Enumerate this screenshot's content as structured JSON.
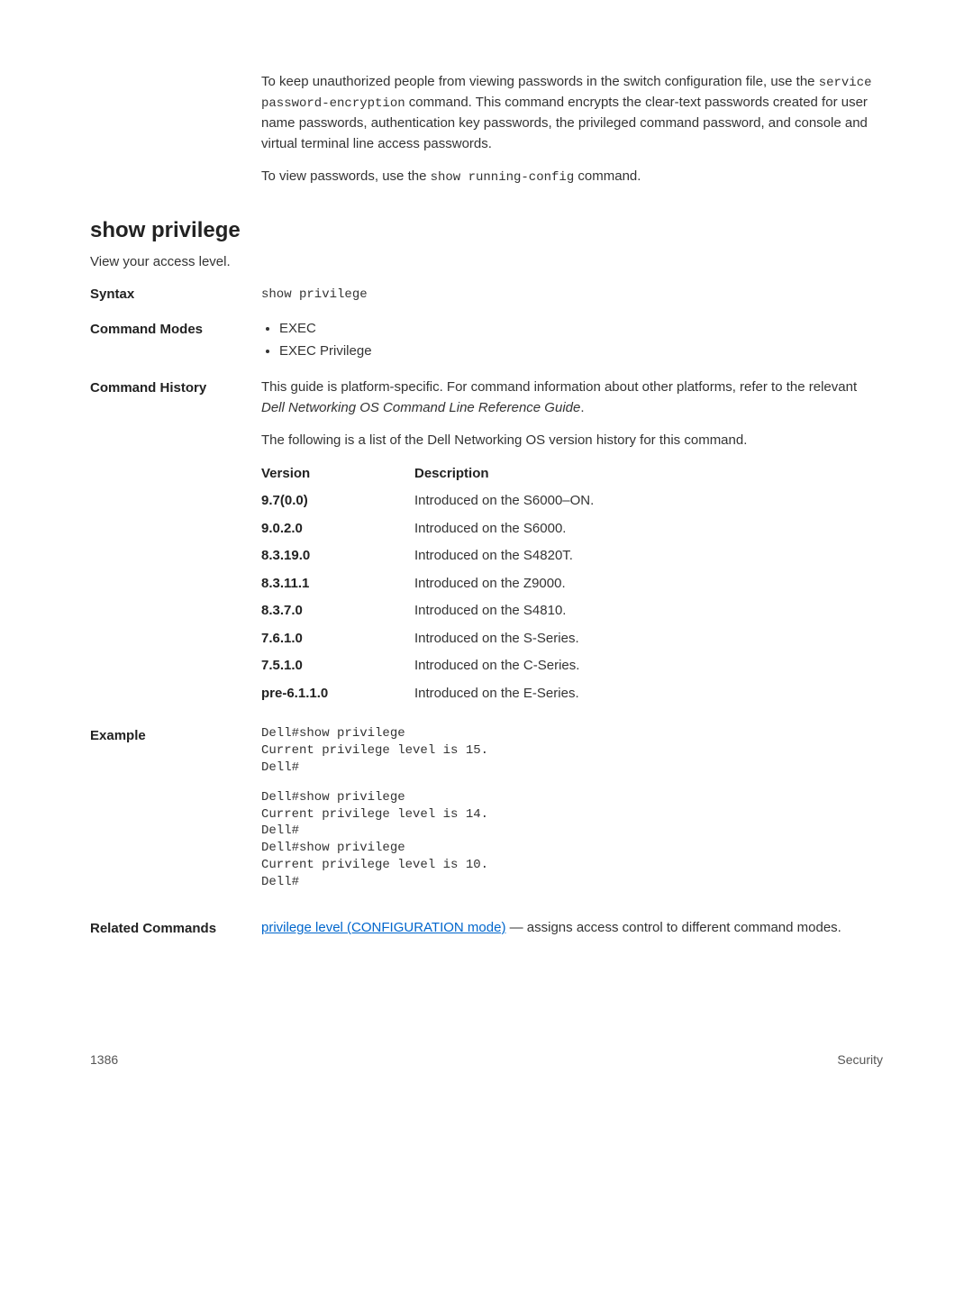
{
  "continuation": {
    "para1_before": "To keep unauthorized people from viewing passwords in the switch configuration file, use the ",
    "para1_code1": "service password-encryption",
    "para1_after": " command. This command encrypts the clear-text passwords created for user name passwords, authentication key passwords, the privileged command password, and console and virtual terminal line access passwords.",
    "para2_before": "To view passwords, use the ",
    "para2_code": "show running-config",
    "para2_after": " command."
  },
  "section": {
    "heading": "show privilege",
    "sub": "View your access level."
  },
  "syntax": {
    "label": "Syntax",
    "value": "show privilege"
  },
  "commandModes": {
    "label": "Command Modes",
    "items": [
      "EXEC",
      "EXEC Privilege"
    ]
  },
  "commandHistory": {
    "label": "Command History",
    "para1_before": "This guide is platform-specific. For command information about other platforms, refer to the relevant ",
    "para1_italic": "Dell Networking OS Command Line Reference Guide",
    "para1_after": ".",
    "para2": "The following is a list of the Dell Networking OS version history for this command.",
    "header": {
      "version": "Version",
      "description": "Description"
    },
    "rows": [
      {
        "version": "9.7(0.0)",
        "description": "Introduced on the S6000–ON."
      },
      {
        "version": "9.0.2.0",
        "description": "Introduced on the S6000."
      },
      {
        "version": "8.3.19.0",
        "description": "Introduced on the S4820T."
      },
      {
        "version": "8.3.11.1",
        "description": "Introduced on the Z9000."
      },
      {
        "version": "8.3.7.0",
        "description": "Introduced on the S4810."
      },
      {
        "version": "7.6.1.0",
        "description": "Introduced on the S-Series."
      },
      {
        "version": "7.5.1.0",
        "description": "Introduced on the C-Series."
      },
      {
        "version": "pre-6.1.1.0",
        "description": "Introduced on the E-Series."
      }
    ]
  },
  "example": {
    "label": "Example",
    "block1": "Dell#show privilege\nCurrent privilege level is 15.\nDell#",
    "block2": "Dell#show privilege\nCurrent privilege level is 14.\nDell#\nDell#show privilege\nCurrent privilege level is 10.\nDell#"
  },
  "related": {
    "label": "Related Commands",
    "linkText": "privilege level (CONFIGURATION mode)",
    "after": " — assigns access control to different command modes."
  },
  "footer": {
    "pageNum": "1386",
    "category": "Security"
  }
}
